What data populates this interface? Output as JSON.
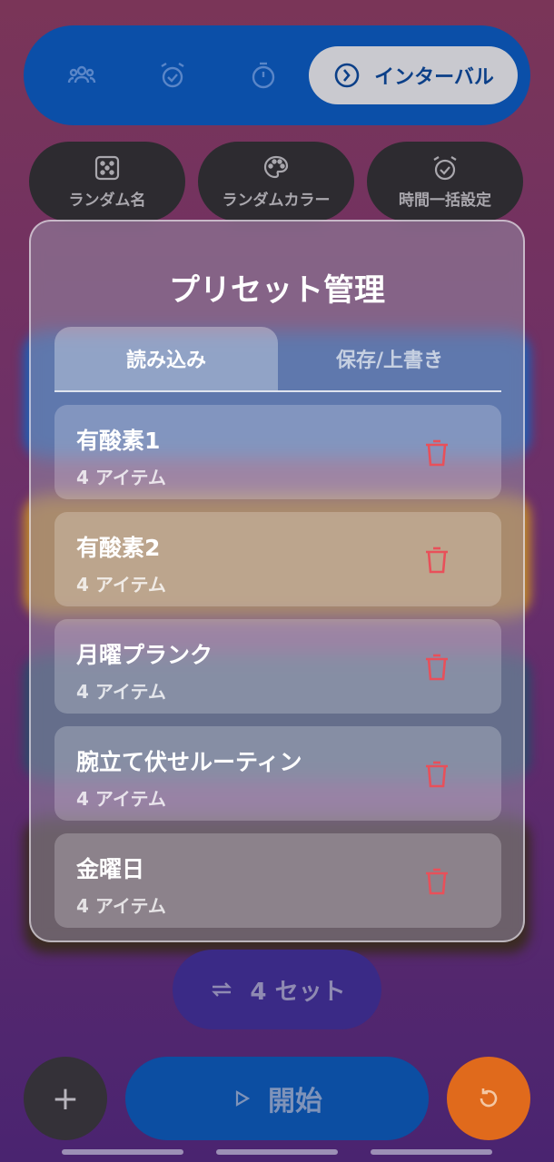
{
  "mode_bar": {
    "active_label": "インターバル",
    "icons": [
      "group-icon",
      "alarm-icon",
      "stopwatch-icon",
      "interval-icon"
    ]
  },
  "tools": [
    {
      "label": "ランダム名",
      "icon": "dice-icon"
    },
    {
      "label": "ランダムカラー",
      "icon": "palette-icon"
    },
    {
      "label": "時間一括設定",
      "icon": "alarm-check-icon"
    }
  ],
  "modal": {
    "title": "プリセット管理",
    "tabs": [
      {
        "label": "読み込み",
        "active": true
      },
      {
        "label": "保存/上書き",
        "active": false
      }
    ],
    "presets": [
      {
        "name": "有酸素1",
        "count": "4 アイテム"
      },
      {
        "name": "有酸素2",
        "count": "4 アイテム"
      },
      {
        "name": "月曜プランク",
        "count": "4 アイテム"
      },
      {
        "name": "腕立て伏せルーティン",
        "count": "4 アイテム"
      },
      {
        "name": "金曜日",
        "count": "4 アイテム"
      }
    ]
  },
  "sets": {
    "label": "4 セット"
  },
  "bottom": {
    "add": "+",
    "start": "開始"
  },
  "colors": {
    "accent_blue": "#0b4fa8",
    "delete_red": "#e8505a",
    "reset_orange": "#e06a1c"
  }
}
